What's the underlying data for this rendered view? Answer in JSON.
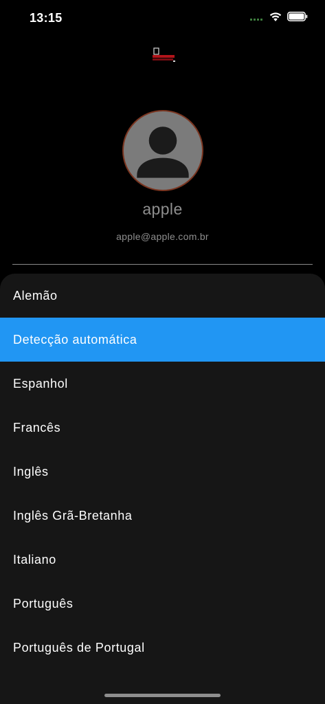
{
  "status_bar": {
    "time": "13:15",
    "signal_icon": "cellular-signal-icon",
    "wifi_icon": "wifi-icon",
    "battery_icon": "battery-icon"
  },
  "header": {
    "logo_icon": "app-logo-icon"
  },
  "profile": {
    "avatar_icon": "person-icon",
    "name": "apple",
    "email": "apple@apple.com.br"
  },
  "language_sheet": {
    "selected_index": 1,
    "items": [
      {
        "label": "Alemão"
      },
      {
        "label": "Detecção automática"
      },
      {
        "label": "Espanhol"
      },
      {
        "label": "Francês"
      },
      {
        "label": "Inglês"
      },
      {
        "label": "Inglês Grã-Bretanha"
      },
      {
        "label": "Italiano"
      },
      {
        "label": "Português"
      },
      {
        "label": "Português de Portugal"
      }
    ]
  },
  "colors": {
    "background": "#000000",
    "sheet": "#161616",
    "selected": "#2196f3",
    "secondary_text": "#8e8e8e",
    "avatar_border": "#7a3520"
  }
}
